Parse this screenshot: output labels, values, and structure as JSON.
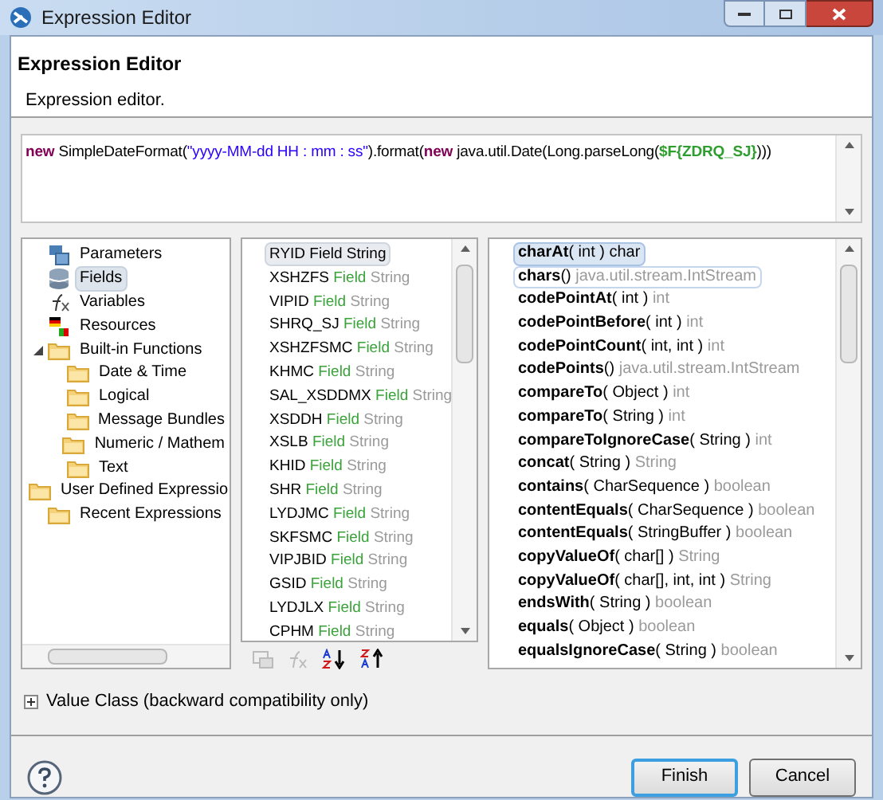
{
  "window": {
    "title": "Expression Editor"
  },
  "header": {
    "title": "Expression Editor",
    "description": "Expression editor."
  },
  "expression": [
    {
      "kind": "keyword",
      "text": "new"
    },
    {
      "kind": "plain",
      "text": " SimpleDateFormat("
    },
    {
      "kind": "string",
      "text": "\"yyyy-MM-dd HH : mm : ss\""
    },
    {
      "kind": "plain",
      "text": ").format("
    },
    {
      "kind": "keyword",
      "text": "new"
    },
    {
      "kind": "plain",
      "text": " java.util.Date(Long.parseLong("
    },
    {
      "kind": "field",
      "text": "$F{ZDRQ_SJ}"
    },
    {
      "kind": "plain",
      "text": ")))"
    }
  ],
  "categories": [
    {
      "label": "Parameters",
      "kind": "parameters",
      "selected": false
    },
    {
      "label": "Fields",
      "kind": "fields",
      "selected": true
    },
    {
      "label": "Variables",
      "kind": "variables",
      "selected": false
    },
    {
      "label": "Resources",
      "kind": "resources",
      "selected": false
    },
    {
      "label": "Built-in Functions",
      "kind": "folder",
      "selected": false,
      "expanded": true,
      "children": [
        {
          "label": "Date & Time",
          "kind": "folder",
          "selected": false
        },
        {
          "label": "Logical",
          "kind": "folder",
          "selected": false
        },
        {
          "label": "Message Bundles",
          "kind": "folder",
          "selected": false
        },
        {
          "label": "Numeric / Mathem",
          "kind": "folder",
          "selected": false
        },
        {
          "label": "Text",
          "kind": "folder",
          "selected": false
        }
      ]
    },
    {
      "label": "User Defined Expressio",
      "kind": "folder",
      "selected": false
    },
    {
      "label": "Recent Expressions",
      "kind": "folder",
      "selected": false
    }
  ],
  "fields": [
    {
      "name": "RYID",
      "category": "Field",
      "type": "String",
      "selected": true
    },
    {
      "name": "XSHZFS",
      "category": "Field",
      "type": "String",
      "selected": false
    },
    {
      "name": "VIPID",
      "category": "Field",
      "type": "String",
      "selected": false
    },
    {
      "name": "SHRQ_SJ",
      "category": "Field",
      "type": "String",
      "selected": false
    },
    {
      "name": "XSHZFSMC",
      "category": "Field",
      "type": "String",
      "selected": false
    },
    {
      "name": "KHMC",
      "category": "Field",
      "type": "String",
      "selected": false
    },
    {
      "name": "SAL_XSDDMX",
      "category": "Field",
      "type": "String",
      "selected": false
    },
    {
      "name": "XSDDH",
      "category": "Field",
      "type": "String",
      "selected": false
    },
    {
      "name": "XSLB",
      "category": "Field",
      "type": "String",
      "selected": false
    },
    {
      "name": "KHID",
      "category": "Field",
      "type": "String",
      "selected": false
    },
    {
      "name": "SHR",
      "category": "Field",
      "type": "String",
      "selected": false
    },
    {
      "name": "LYDJMC",
      "category": "Field",
      "type": "String",
      "selected": false
    },
    {
      "name": "SKFSMC",
      "category": "Field",
      "type": "String",
      "selected": false
    },
    {
      "name": "VIPJBID",
      "category": "Field",
      "type": "String",
      "selected": false
    },
    {
      "name": "GSID",
      "category": "Field",
      "type": "String",
      "selected": false
    },
    {
      "name": "LYDJLX",
      "category": "Field",
      "type": "String",
      "selected": false
    },
    {
      "name": "CPHM",
      "category": "Field",
      "type": "String",
      "selected": false
    }
  ],
  "methods": [
    {
      "name": "charAt",
      "params": "( int )",
      "returns": "char",
      "selected": true,
      "hovered": false
    },
    {
      "name": "chars",
      "params": "()",
      "returns": "java.util.stream.IntStream",
      "selected": false,
      "hovered": true
    },
    {
      "name": "codePointAt",
      "params": "( int )",
      "returns": "int",
      "selected": false,
      "hovered": false
    },
    {
      "name": "codePointBefore",
      "params": "( int )",
      "returns": "int",
      "selected": false,
      "hovered": false
    },
    {
      "name": "codePointCount",
      "params": "( int, int )",
      "returns": "int",
      "selected": false,
      "hovered": false
    },
    {
      "name": "codePoints",
      "params": "()",
      "returns": "java.util.stream.IntStream",
      "selected": false,
      "hovered": false
    },
    {
      "name": "compareTo",
      "params": "( Object )",
      "returns": "int",
      "selected": false,
      "hovered": false
    },
    {
      "name": "compareTo",
      "params": "( String )",
      "returns": "int",
      "selected": false,
      "hovered": false
    },
    {
      "name": "compareToIgnoreCase",
      "params": "( String )",
      "returns": "int",
      "selected": false,
      "hovered": false
    },
    {
      "name": "concat",
      "params": "( String )",
      "returns": "String",
      "selected": false,
      "hovered": false
    },
    {
      "name": "contains",
      "params": "( CharSequence )",
      "returns": "boolean",
      "selected": false,
      "hovered": false
    },
    {
      "name": "contentEquals",
      "params": "( CharSequence )",
      "returns": "boolean",
      "selected": false,
      "hovered": false
    },
    {
      "name": "contentEquals",
      "params": "( StringBuffer )",
      "returns": "boolean",
      "selected": false,
      "hovered": false
    },
    {
      "name": "copyValueOf",
      "params": "( char[] )",
      "returns": "String",
      "selected": false,
      "hovered": false
    },
    {
      "name": "copyValueOf",
      "params": "( char[], int, int )",
      "returns": "String",
      "selected": false,
      "hovered": false
    },
    {
      "name": "endsWith",
      "params": "( String )",
      "returns": "boolean",
      "selected": false,
      "hovered": false
    },
    {
      "name": "equals",
      "params": "( Object )",
      "returns": "boolean",
      "selected": false,
      "hovered": false
    },
    {
      "name": "equalsIgnoreCase",
      "params": "( String )",
      "returns": "boolean",
      "selected": false,
      "hovered": false
    }
  ],
  "value_class": {
    "label": "Value Class (backward compatibility only)",
    "expanded": false
  },
  "buttons": [
    {
      "label": "Finish",
      "default": true
    },
    {
      "label": "Cancel",
      "default": false
    }
  ]
}
